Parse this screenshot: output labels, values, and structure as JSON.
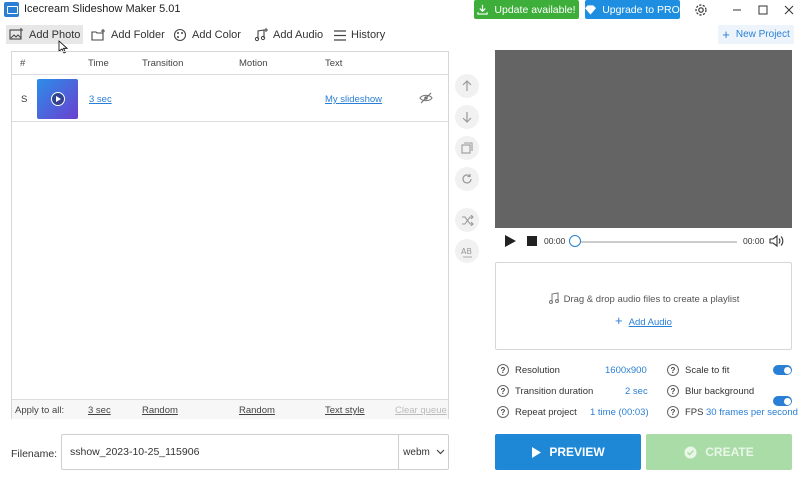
{
  "window": {
    "title": "Icecream Slideshow Maker 5.01",
    "update_label": "Update available!",
    "pro_label": "Upgrade to PRO"
  },
  "toolbar": {
    "add_photo": "Add Photo",
    "add_folder": "Add Folder",
    "add_color": "Add Color",
    "add_audio": "Add Audio",
    "history": "History",
    "new_project": "New Project"
  },
  "table": {
    "headers": {
      "num": "#",
      "time": "Time",
      "transition": "Transition",
      "motion": "Motion",
      "text": "Text"
    },
    "rows": [
      {
        "num": "S",
        "time": "3 sec",
        "text": "My slideshow"
      }
    ],
    "apply_all": {
      "label": "Apply to all:",
      "time": "3 sec",
      "transition": "Random",
      "motion": "Random",
      "text": "Text style",
      "clear": "Clear queue"
    }
  },
  "file": {
    "label": "Filename:",
    "value": "sshow_2023-10-25_115906",
    "format": "webm"
  },
  "player": {
    "time_start": "00:00",
    "time_end": "00:00",
    "progress": 0
  },
  "audio": {
    "drop_text": "Drag & drop audio files to create a playlist",
    "add_label": "Add Audio"
  },
  "settings": {
    "resolution": {
      "label": "Resolution",
      "value": "1600x900"
    },
    "transition_duration": {
      "label": "Transition duration",
      "value": "2 sec"
    },
    "repeat_project": {
      "label": "Repeat project",
      "value": "1 time (00:03)"
    },
    "scale_to_fit": {
      "label": "Scale to fit",
      "on": true
    },
    "blur_background": {
      "label": "Blur background",
      "on": true
    },
    "fps": {
      "label": "FPS",
      "value": "30 frames per second"
    }
  },
  "actions": {
    "preview": "PREVIEW",
    "create": "CREATE"
  },
  "colors": {
    "accent": "#2a7fd4",
    "update_green": "#3eae3a",
    "pro_blue": "#1e8fe0",
    "preview_bg": "#646464",
    "create_disabled": "#a9dca7"
  }
}
